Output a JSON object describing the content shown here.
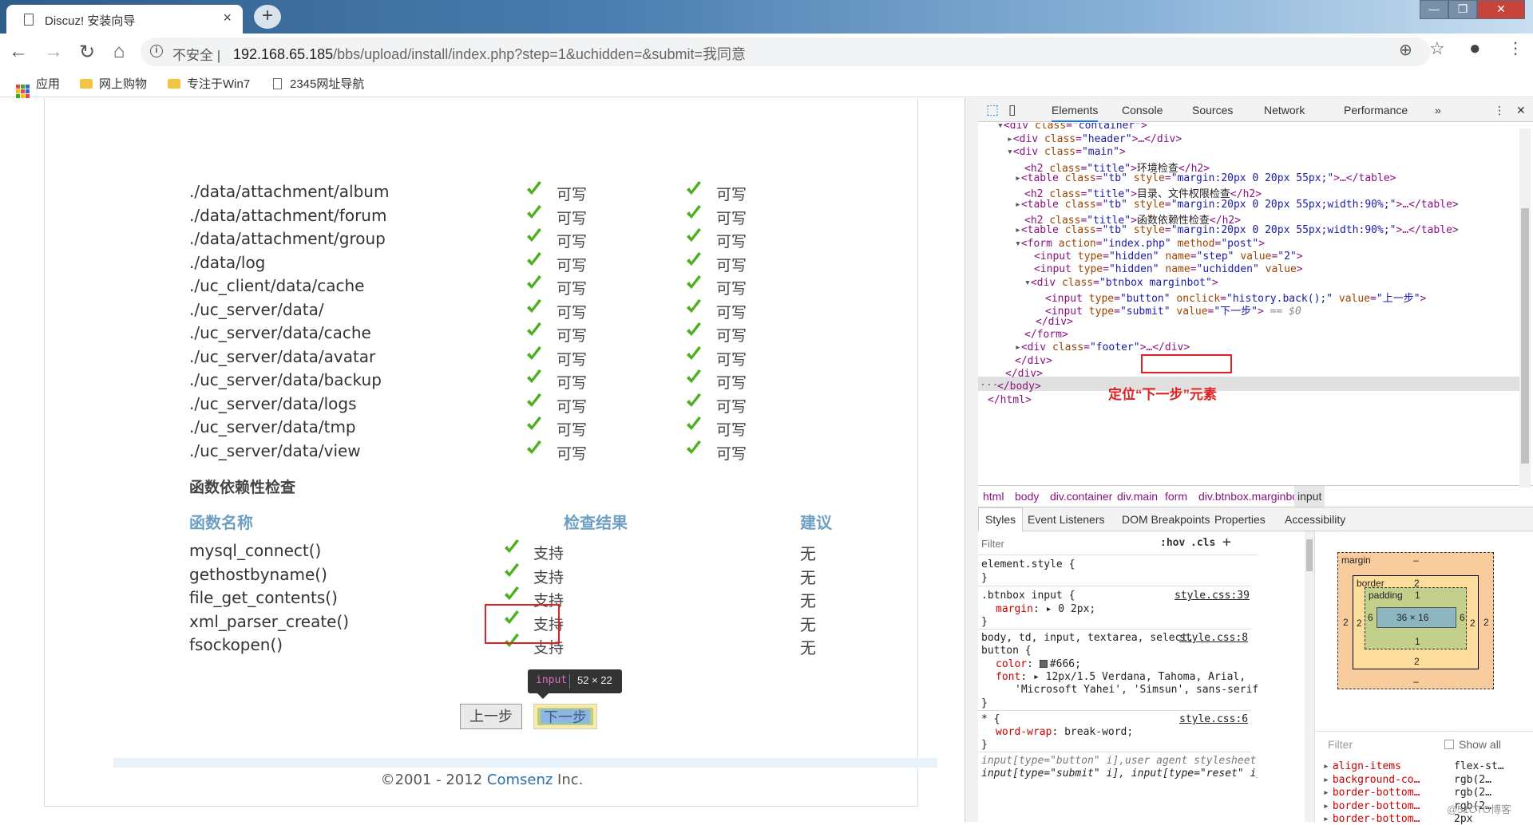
{
  "browser": {
    "tab_title": "Discuz! 安装向导",
    "tab_close": "×",
    "new_tab": "+",
    "win_min": "—",
    "win_max": "❐",
    "win_close": "✕",
    "nav_back": "←",
    "nav_forward": "→",
    "nav_reload": "↻",
    "nav_home": "⌂",
    "insecure_label": "不安全 |",
    "url_host": "192.168.65.185",
    "url_rest": "/bbs/upload/install/index.php?step=1&uchidden=&submit=我同意",
    "zoom_icon": "⊕",
    "star_icon": "☆",
    "account_icon": "●",
    "menu_icon": "⋮",
    "bookmarks": [
      "应用",
      "网上购物",
      "专注于Win7",
      "2345网址导航"
    ]
  },
  "page": {
    "dir_rows": [
      "./data/attachment/album",
      "./data/attachment/forum",
      "./data/attachment/group",
      "./data/log",
      "./uc_client/data/cache",
      "./uc_server/data/",
      "./uc_server/data/cache",
      "./uc_server/data/avatar",
      "./uc_server/data/backup",
      "./uc_server/data/logs",
      "./uc_server/data/tmp",
      "./uc_server/data/view"
    ],
    "writable_label": "可写",
    "func_section_title": "函数依赖性检查",
    "func_headers": [
      "函数名称",
      "检查结果",
      "建议"
    ],
    "functions": [
      "mysql_connect()",
      "gethostbyname()",
      "file_get_contents()",
      "xml_parser_create()",
      "fsockopen()"
    ],
    "supported_label": "支持",
    "advice_label": "无",
    "prev_button": "上一步",
    "next_button": "下一步",
    "tooltip_tag": "input",
    "tooltip_dims": "52 × 22",
    "copyright_prefix": "©2001 - 2012 ",
    "copyright_company": "Comsenz",
    "copyright_suffix": " Inc."
  },
  "devtools": {
    "tabs": [
      "Elements",
      "Console",
      "Sources",
      "Network",
      "Performance",
      "»"
    ],
    "more_icon": "⋮",
    "close_icon": "✕",
    "annotation": "定位“下一步”元素",
    "dots": "...",
    "breadcrumbs": [
      "html",
      "body",
      "div.container",
      "div.main",
      "form",
      "div.btnbox.marginbot",
      "input"
    ],
    "sub_tabs": [
      "Styles",
      "Event Listeners",
      "DOM Breakpoints",
      "Properties",
      "Accessibility"
    ],
    "filter_placeholder": "Filter",
    "hov": ":hov",
    "cls": ".cls",
    "plus": "+",
    "styles": {
      "element_style": "element.style {",
      "close_brace": "}",
      "btnbox_selector": ".btnbox input {",
      "btnbox_src": "style.css:39",
      "btnbox_prop": "margin",
      "btnbox_val": ": ▸ 0 2px;",
      "body_selector_1": "body, td, input, textarea, select,",
      "body_selector_2": "button {",
      "body_src": "style.css:8",
      "color_prop": "color",
      "color_val": "#666;",
      "font_prop": "font",
      "font_val_1": ": ▸ 12px/1.5 Verdana, Tahoma, Arial,",
      "font_val_2": "'Microsoft Yahei', 'Simsun', sans-serif;",
      "star_selector": "* {",
      "star_src": "style.css:6",
      "wrap_prop": "word-wrap",
      "wrap_val": ": break-word;",
      "ua_1": "input[type=\"button\" i],",
      "ua_label": "user agent stylesheet",
      "ua_2": "input[type=\"submit\" i], input[type=\"reset\" i],"
    },
    "box_model": {
      "margin_label": "margin",
      "margin_top": "–",
      "margin_bottom": "–",
      "margin_left": "2",
      "margin_right": "2",
      "border_label": "border",
      "border_top": "2",
      "border_bottom": "2",
      "border_left": "2",
      "border_right": "2",
      "padding_label": "padding",
      "padding_top": "1",
      "padding_bottom": "1",
      "padding_left": "6",
      "padding_right": "6",
      "content": "36 × 16"
    },
    "computed": {
      "filter": "Filter",
      "show_all": "Show all",
      "props": [
        {
          "k": "align-items",
          "v": "flex-st…"
        },
        {
          "k": "background-co…",
          "v": "rgb(2…"
        },
        {
          "k": "border-bottom…",
          "v": "rgb(2…"
        },
        {
          "k": "border-bottom…",
          "v": "rgb(2…"
        },
        {
          "k": "border-bottom…",
          "v": "2px"
        }
      ]
    },
    "watermark": "@51CTO博客"
  },
  "colors": {
    "check_green": "#4caf1e",
    "annotation_red": "#e02020",
    "link_blue": "#2a6fa8",
    "devtools_tag": "#881280"
  }
}
